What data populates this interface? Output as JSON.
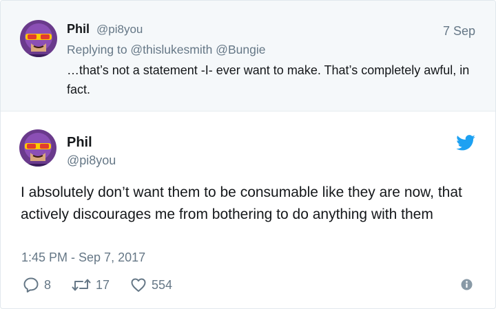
{
  "parent_tweet": {
    "name": "Phil",
    "handle": "@pi8you",
    "date": "7 Sep",
    "reply_context": "Replying to @thislukesmith @Bungie",
    "text": "…that’s not a statement -I- ever want to make. That’s completely awful, in fact."
  },
  "main_tweet": {
    "name": "Phil",
    "handle": "@pi8you",
    "text": "I absolutely don’t want them to be consumable like they are now, that actively discourages me from bothering to do anything with them",
    "timestamp": "1:45 PM - Sep 7, 2017",
    "reply_count": "8",
    "retweet_count": "17",
    "like_count": "554",
    "icons": [
      "twitter-bird-icon",
      "reply-icon",
      "retweet-icon",
      "heart-icon",
      "info-icon"
    ]
  },
  "colors": {
    "twitter_blue": "#1da1f2",
    "secondary_text": "#657786",
    "primary_text": "#14171a",
    "parent_background": "#f5f8fa"
  }
}
